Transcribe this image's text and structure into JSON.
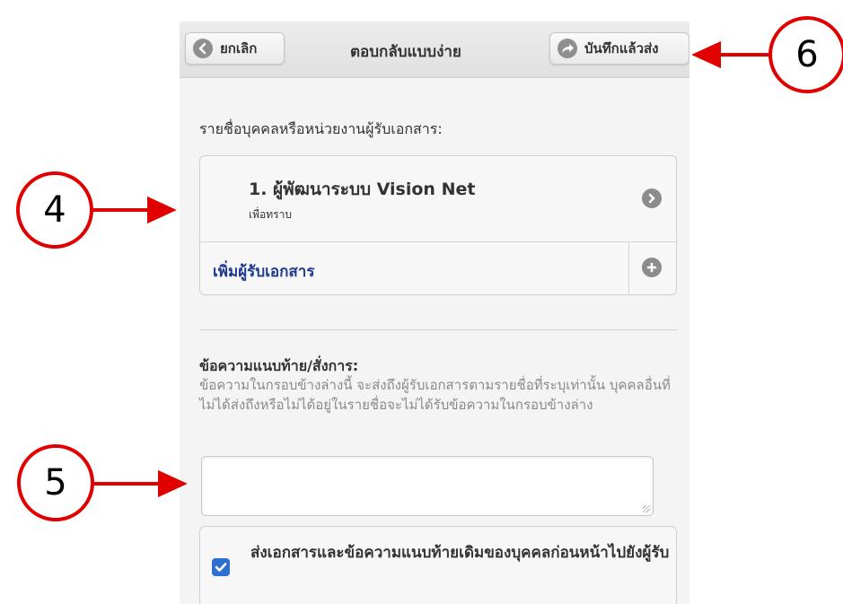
{
  "header": {
    "cancel_label": "ยกเลิก",
    "title": "ตอบกลับแบบง่าย",
    "save_label": "บันทึกแล้วส่ง"
  },
  "recipients": {
    "section_label": "รายชื่อบุคคลหรือหน่วยงานผู้รับเอกสาร:",
    "items": [
      {
        "title": "1. ผู้พัฒนาระบบ Vision Net",
        "subtitle": "เพื่อทราบ"
      }
    ],
    "add_label": "เพิ่มผู้รับเอกสาร"
  },
  "message": {
    "label": "ข้อความแนบท้าย/สั่งการ:",
    "help": "ข้อความในกรอบข้างล่างนี้ จะส่งถึงผู้รับเอกสารตามรายชื่อที่ระบุเท่านั้น บุคคลอื่นที่ไม่ได้ส่งถึงหรือไม่ได้อยู่ในรายชื่อจะไม่ได้รับข้อความในกรอบข้างล่าง",
    "value": ""
  },
  "forward_option": {
    "label": "ส่งเอกสารและข้อความแนบท้ายเดิมของบุคคลก่อนหน้าไปยังผู้รับ",
    "checked": true
  },
  "annotations": {
    "step_4": "4",
    "step_5": "5",
    "step_6": "6",
    "color": "#e00000"
  }
}
